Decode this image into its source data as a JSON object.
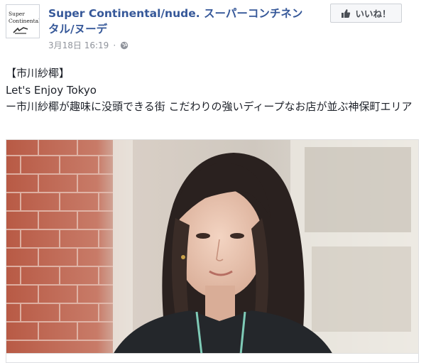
{
  "page": {
    "avatar": {
      "line1": "Super",
      "line2": "Continental"
    },
    "name": "Super Continental/nude. スーパーコンチネンタル/ヌーデ",
    "timestamp": "3月18日 16:19",
    "meta_separator": "·",
    "like_button": "いいね！"
  },
  "post": {
    "line1": "【市川紗椰】",
    "line2": "Let's Enjoy Tokyo",
    "line3": "ー市川紗椰が趣味に没頭できる街 こだわりの強いディープなお店が並ぶ神保町エリア"
  },
  "icons": {
    "like": "thumbs-up-icon",
    "privacy": "globe-icon"
  },
  "colors": {
    "link": "#365899",
    "meta": "#90949c",
    "text": "#1d2129",
    "button_bg": "#f6f7f9"
  }
}
